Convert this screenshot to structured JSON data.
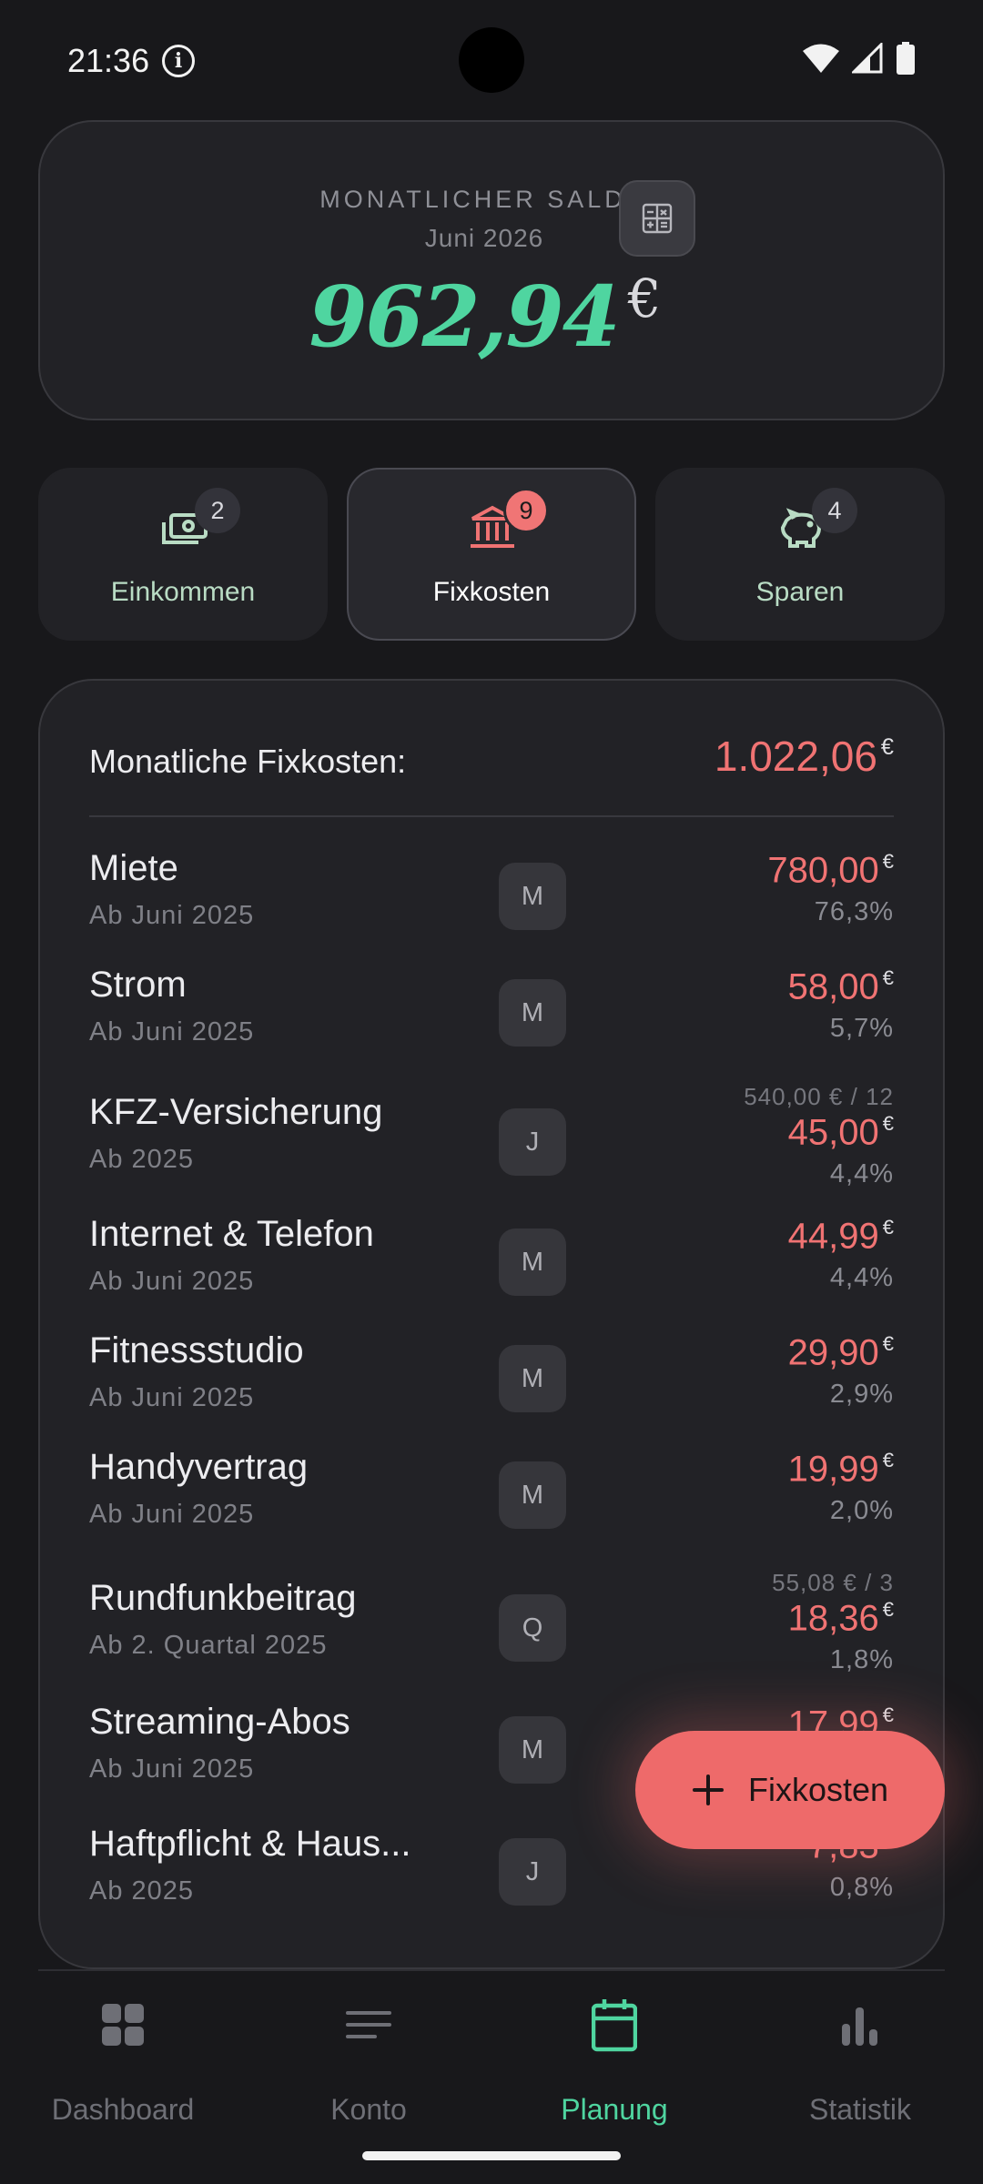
{
  "status_bar": {
    "time": "21:36"
  },
  "saldo": {
    "label": "MONATLICHER SALDO",
    "month": "Juni 2026",
    "value": "962,94",
    "currency": "€"
  },
  "tabs": [
    {
      "label": "Einkommen",
      "count": "2",
      "icon": "money-icon",
      "active": false
    },
    {
      "label": "Fixkosten",
      "count": "9",
      "icon": "bank-icon",
      "active": true
    },
    {
      "label": "Sparen",
      "count": "4",
      "icon": "piggy-bank-icon",
      "active": false
    }
  ],
  "fixkosten": {
    "total_label": "Monatliche Fixkosten:",
    "total_value": "1.022,06",
    "currency": "€",
    "items": [
      {
        "name": "Miete",
        "since": "Ab Juni 2025",
        "freq": "M",
        "note": "",
        "amount": "780,00",
        "pct": "76,3%"
      },
      {
        "name": "Strom",
        "since": "Ab Juni 2025",
        "freq": "M",
        "note": "",
        "amount": "58,00",
        "pct": "5,7%"
      },
      {
        "name": "KFZ-Versicherung",
        "since": "Ab 2025",
        "freq": "J",
        "note": "540,00 € / 12",
        "amount": "45,00",
        "pct": "4,4%"
      },
      {
        "name": "Internet & Telefon",
        "since": "Ab Juni 2025",
        "freq": "M",
        "note": "",
        "amount": "44,99",
        "pct": "4,4%"
      },
      {
        "name": "Fitnessstudio",
        "since": "Ab Juni 2025",
        "freq": "M",
        "note": "",
        "amount": "29,90",
        "pct": "2,9%"
      },
      {
        "name": "Handyvertrag",
        "since": "Ab Juni 2025",
        "freq": "M",
        "note": "",
        "amount": "19,99",
        "pct": "2,0%"
      },
      {
        "name": "Rundfunkbeitrag",
        "since": "Ab 2. Quartal 2025",
        "freq": "Q",
        "note": "55,08 € / 3",
        "amount": "18,36",
        "pct": "1,8%"
      },
      {
        "name": "Streaming-Abos",
        "since": "Ab Juni 2025",
        "freq": "M",
        "note": "",
        "amount": "17,99",
        "pct": ""
      },
      {
        "name": "Haftpflicht & Haus...",
        "since": "Ab 2025",
        "freq": "J",
        "note": "",
        "amount": "7,83",
        "pct": "0,8%"
      }
    ]
  },
  "fab": {
    "label": "Fixkosten"
  },
  "nav": [
    {
      "label": "Dashboard",
      "icon": "grid-icon",
      "active": false
    },
    {
      "label": "Konto",
      "icon": "lines-icon",
      "active": false
    },
    {
      "label": "Planung",
      "icon": "calendar-icon",
      "active": true
    },
    {
      "label": "Statistik",
      "icon": "bar-chart-icon",
      "active": false
    }
  ],
  "colors": {
    "accent_green": "#4fd5a0",
    "accent_red": "#f07373",
    "background": "#18181b",
    "card": "#222226"
  }
}
